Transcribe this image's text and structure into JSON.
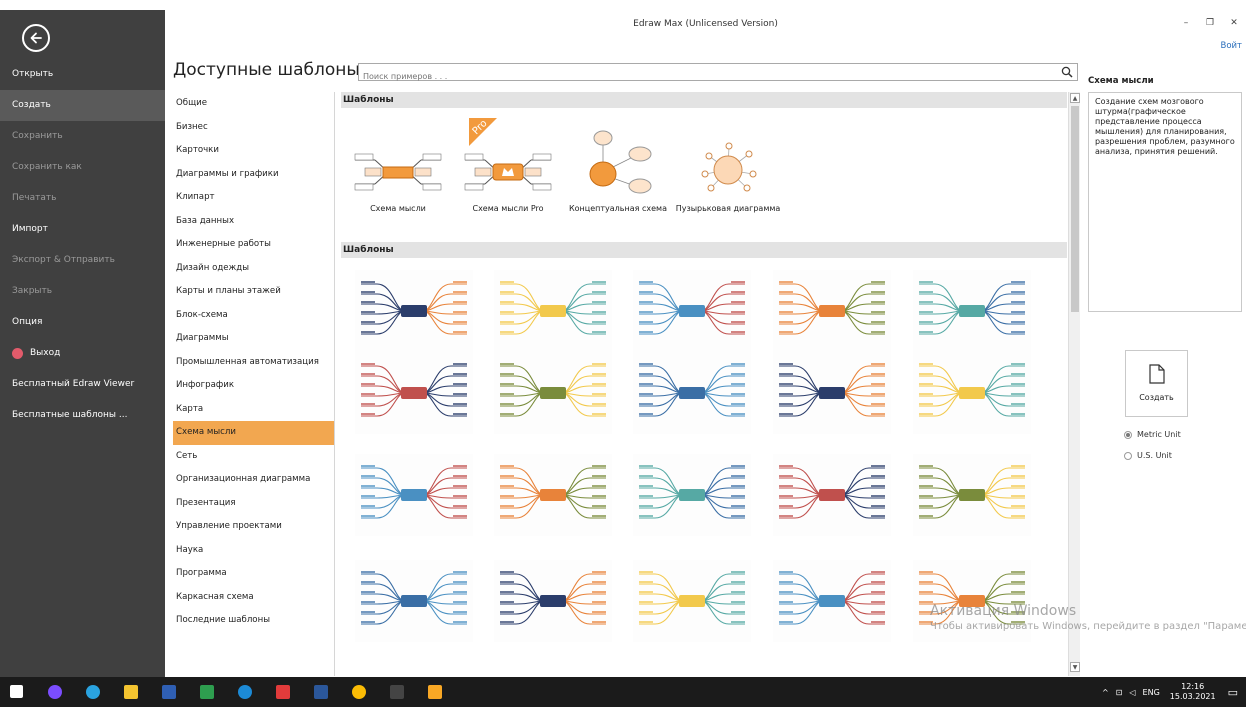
{
  "window": {
    "title": "Edraw Max (Unlicensed Version)",
    "controls": [
      "–",
      "❐",
      "✕"
    ],
    "login": "Войт"
  },
  "sidebar": {
    "back_icon": "arrow-left-circle-icon",
    "items": [
      {
        "label": "Открыть",
        "state": "normal"
      },
      {
        "label": "Создать",
        "state": "active"
      },
      {
        "label": "Сохранить",
        "state": "dim"
      },
      {
        "label": "Сохранить как",
        "state": "dim"
      },
      {
        "label": "Печатать",
        "state": "dim"
      },
      {
        "label": "Импорт",
        "state": "normal"
      },
      {
        "label": "Экспорт & Отправить",
        "state": "dim"
      },
      {
        "label": "Закрыть",
        "state": "dim"
      },
      {
        "label": "Опция",
        "state": "normal"
      },
      {
        "label": "Выход",
        "state": "exit"
      },
      {
        "label": "Бесплатный Edraw Viewer",
        "state": "normal"
      },
      {
        "label": "Бесплатные шаблоны ...",
        "state": "normal"
      }
    ]
  },
  "header": {
    "heading": "Доступные шаблоны",
    "search_placeholder": "Поиск примеров . . ."
  },
  "categories": {
    "selected_index": 14,
    "items": [
      "Общие",
      "Бизнес",
      "Карточки",
      "Диаграммы и графики",
      "Клипарт",
      "База данных",
      "Инженерные работы",
      "Дизайн одежды",
      "Карты и планы этажей",
      "Блок-схема",
      "Диаграммы",
      "Промышленная автоматизация",
      "Инфографик",
      "Карта",
      "Схема мысли",
      "Сеть",
      "Организационная диаграмма",
      "Презентация",
      "Управление проектами",
      "Наука",
      "Программа",
      "Каркасная схема",
      "Последние шаблоны"
    ]
  },
  "content": {
    "section1": "Шаблоны",
    "section2": "Шаблоны",
    "templates": [
      {
        "label": "Схема мысли"
      },
      {
        "label": "Схема мысли Pro"
      },
      {
        "label": "Концептуальная схема"
      },
      {
        "label": "Пузырьковая диаграмма"
      }
    ],
    "pro_badge": "Pro",
    "example_count": 20
  },
  "info_panel": {
    "title": "Схема мысли",
    "description": "Создание схем мозгового штурма(графическое представление процесса мышления) для планирования, разрешения проблем, разумного анализа, принятия решений.",
    "create_label": "Создать",
    "units": [
      {
        "label": "Metric Unit",
        "checked": true
      },
      {
        "label": "U.S. Unit",
        "checked": false
      }
    ]
  },
  "watermark": {
    "line1": "Активация Windows",
    "line2": "Чтобы активировать Windows, перейдите в раздел \"Параметры\"."
  },
  "taskbar": {
    "icons": [
      "windows-start-icon",
      "alice-icon",
      "telegram-icon",
      "file-explorer-icon",
      "save-disk-icon",
      "edraw-icon",
      "edge-icon",
      "yandex-icon",
      "word-icon",
      "chrome-icon",
      "paint-icon",
      "active-app-icon"
    ],
    "tray": {
      "lang": "ENG",
      "time": "12:16",
      "date": "15.03.2021"
    },
    "colors": [
      "#0078d7",
      "#7b4dff",
      "#2aa3e0",
      "#f4c430",
      "#2f5fb3",
      "#2e9e4f",
      "#1c8ad6",
      "#e23b3b",
      "#2b579a",
      "#fbbc05",
      "#444",
      "#f9a825"
    ]
  },
  "colors": {
    "sidebar": "#404040",
    "accent": "#f2a750",
    "section": "#e3e3e3"
  }
}
